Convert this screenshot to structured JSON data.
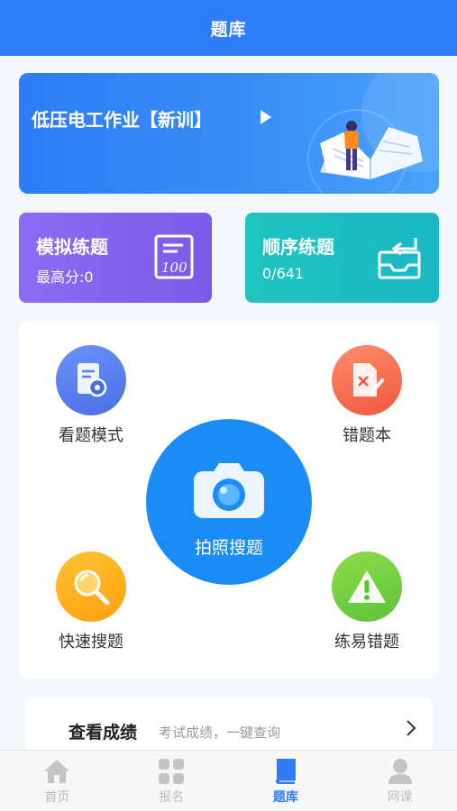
{
  "header": {
    "title": "题库"
  },
  "banner": {
    "title": "低压电工作业【新训】"
  },
  "cards": {
    "mock": {
      "title": "模拟练题",
      "subtitle": "最高分:0"
    },
    "sequence": {
      "title": "顺序练题",
      "subtitle": "0/641"
    }
  },
  "features": {
    "view_mode": "看题模式",
    "wrong_book": "错题本",
    "photo_search": "拍照搜题",
    "quick_search": "快速搜题",
    "easy_mistakes": "练易错题"
  },
  "score": {
    "title": "查看成绩",
    "subtitle": "考试成绩，一键查询"
  },
  "tabs": [
    {
      "label": "首页",
      "icon": "home-icon"
    },
    {
      "label": "报名",
      "icon": "grid-icon"
    },
    {
      "label": "题库",
      "icon": "book-icon"
    },
    {
      "label": "网课",
      "icon": "user-icon"
    }
  ],
  "colors": {
    "primary": "#2e7cf6",
    "photo": "#1b8cf5",
    "mock": "#7a5ae8",
    "sequence": "#1fc4c0"
  }
}
